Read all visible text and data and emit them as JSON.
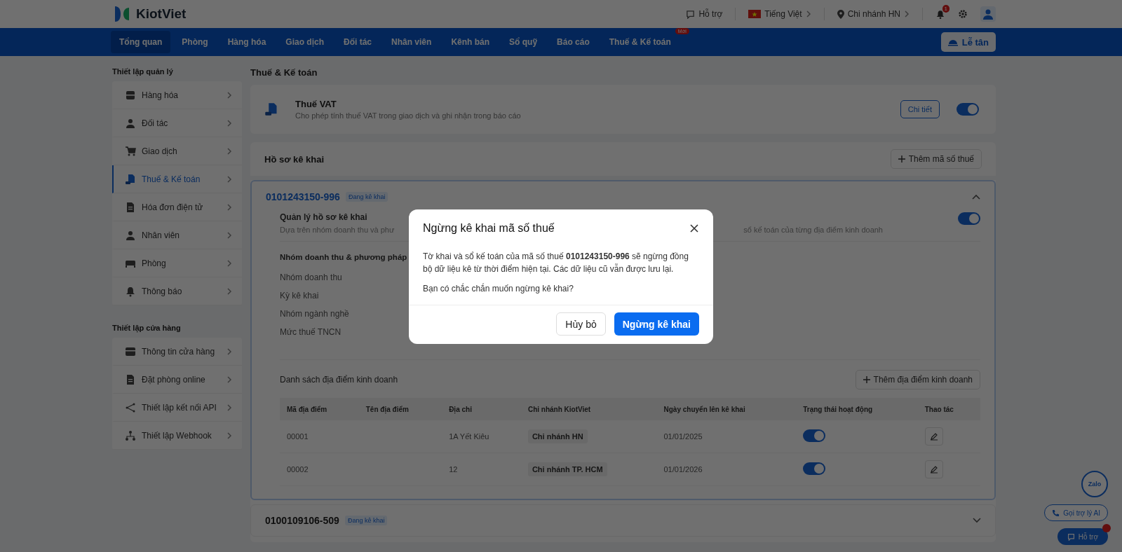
{
  "header": {
    "brand": "KiotViet",
    "support": "Hỗ trợ",
    "language": "Tiếng Việt",
    "branch": "Chi nhánh HN",
    "notification_count": "1"
  },
  "nav": {
    "items": [
      {
        "label": "Tổng quan",
        "selected": true
      },
      {
        "label": "Phòng",
        "selected": false
      },
      {
        "label": "Hàng hóa",
        "selected": false
      },
      {
        "label": "Giao dịch",
        "selected": false
      },
      {
        "label": "Đối tác",
        "selected": false
      },
      {
        "label": "Nhân viên",
        "selected": false
      },
      {
        "label": "Kênh bán",
        "selected": false
      },
      {
        "label": "Sổ quỹ",
        "selected": false
      },
      {
        "label": "Báo cáo",
        "selected": false
      },
      {
        "label": "Thuế & Kế toán",
        "selected": false,
        "badge": "Mới"
      }
    ],
    "reception_button": "Lễ tân"
  },
  "sidebar": {
    "groups": [
      {
        "title": "Thiết lập quản lý",
        "items": [
          {
            "label": "Hàng hóa",
            "selected": false
          },
          {
            "label": "Đối tác",
            "selected": false
          },
          {
            "label": "Giao dịch",
            "selected": false
          },
          {
            "label": "Thuế & Kế toán",
            "selected": true
          },
          {
            "label": "Hóa đơn điện tử",
            "selected": false
          },
          {
            "label": "Nhân viên",
            "selected": false
          },
          {
            "label": "Phòng",
            "selected": false
          },
          {
            "label": "Thông báo",
            "selected": false
          }
        ]
      },
      {
        "title": "Thiết lập cửa hàng",
        "items": [
          {
            "label": "Thông tin cửa hàng",
            "selected": false
          },
          {
            "label": "Đặt phòng online",
            "selected": false
          },
          {
            "label": "Thiết lập kết nối API",
            "selected": false
          },
          {
            "label": "Thiết lập Webhook",
            "selected": false
          }
        ]
      }
    ]
  },
  "page_title": "Thuế & Kế toán",
  "vat": {
    "title": "Thuế VAT",
    "description": "Cho phép tính thuế VAT trong giao dịch và ghi nhận trong báo cáo",
    "details_button": "Chi tiết",
    "enabled": true
  },
  "profiles_section": {
    "title": "Hồ sơ kê khai",
    "add_button": "Thêm mã số thuế"
  },
  "profiles": [
    {
      "tax_code": "0101243150-996",
      "status": "Đang kê khai",
      "expanded": true,
      "management": {
        "title": "Quản lý hồ sơ kê khai",
        "description_start": "Dựa trên nhóm doanh thu và phư",
        "description_end": "sổ kế toán của từng địa điểm kinh doanh",
        "enabled": true
      },
      "revenue_heading": "Nhóm doanh thu & phương pháp",
      "fields": [
        "Nhóm doanh thu",
        "Kỳ kê khai",
        "Nhóm ngành nghề",
        "Mức thuế TNCN"
      ],
      "locations_title": "Danh sách địa điểm kinh doanh",
      "add_location_button": "Thêm địa điểm kinh doanh",
      "table": {
        "columns": [
          "Mã địa điểm",
          "Tên địa điểm",
          "Địa chỉ",
          "Chi nhánh KiotViet",
          "Ngày chuyển lên kê khai",
          "Trạng thái hoạt động",
          "Thao tác"
        ],
        "rows": [
          {
            "code": "00001",
            "address": "1A Yết Kiêu",
            "branch": "Chi nhánh HN",
            "date": "01/01/2025",
            "active": true
          },
          {
            "code": "00002",
            "address": "12",
            "branch": "Chi nhánh TP. HCM",
            "date": "01/01/2026",
            "active": true
          }
        ]
      }
    },
    {
      "tax_code": "0100109106-509",
      "status": "Đang kê khai",
      "expanded": false
    }
  ],
  "floating": {
    "zalo": "Zalo",
    "ai_button": "Gọi trợ lý AI",
    "support_button": "Hỗ trợ"
  },
  "dialog": {
    "title": "Ngừng kê khai mã số thuế",
    "message": "Tờ khai và sổ kế toán của mã số thuế **0101243150-996** sẽ ngừng đồng bộ dữ liệu kê từ thời điểm hiện tại. Các dữ liệu cũ vẫn được lưu lại.",
    "question": "Bạn có chắc chắn muốn ngừng kê khai?",
    "cancel_button": "Hủy bỏ",
    "confirm_button": "Ngừng kê khai"
  }
}
